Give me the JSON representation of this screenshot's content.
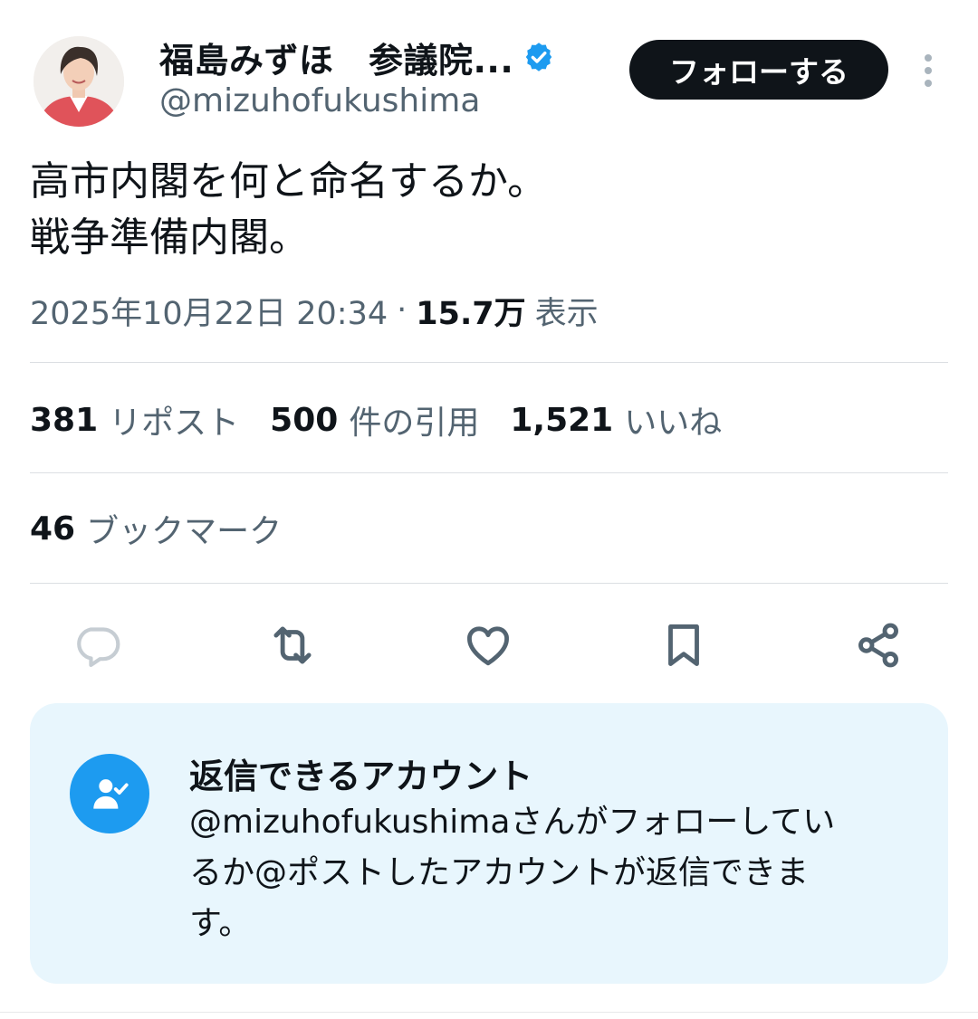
{
  "author": {
    "name": "福島みずほ　参議院...",
    "handle": "@mizuhofukushima",
    "verified_icon": "verified-badge",
    "accent": "#1d9bf0"
  },
  "follow_button": {
    "label": "フォローする"
  },
  "tweet": {
    "lines": [
      "高市内閣を何と命名するか。",
      "戦争準備内閣。"
    ]
  },
  "meta": {
    "datetime": "2025年10月22日 20:34",
    "separator": "·",
    "views_count": "15.7万",
    "views_label": "表示"
  },
  "stats": {
    "reposts": {
      "count": "381",
      "label": "リポスト"
    },
    "quotes": {
      "count": "500",
      "label": "件の引用"
    },
    "likes": {
      "count": "1,521",
      "label": "いいね"
    },
    "bookmarks": {
      "count": "46",
      "label": "ブックマーク"
    }
  },
  "actions": [
    "reply-icon",
    "repost-icon",
    "like-icon",
    "bookmark-icon",
    "share-icon"
  ],
  "reply_notice": {
    "title": "返信できるアカウント",
    "body_lines": [
      "@mizuhofukushimaさんがフォローしてい",
      "るか@ポストしたアカウントが返信できま",
      "す。"
    ]
  }
}
